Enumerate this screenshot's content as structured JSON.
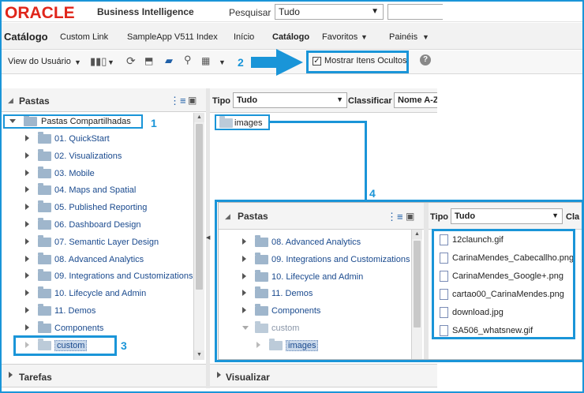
{
  "topbar": {
    "logo": "ORACLE",
    "product": "Business Intelligence",
    "search_label": "Pesquisar",
    "search_scope": "Tudo"
  },
  "nav": {
    "title": "Catálogo",
    "items": [
      "Custom Link",
      "SampleApp V511 Index",
      "Início",
      "Catálogo",
      "Favoritos",
      "Painéis"
    ]
  },
  "toolbar": {
    "view_label": "View do Usuário",
    "show_hidden_label": "Mostrar Itens Ocultos",
    "show_hidden_checked": true
  },
  "left_panel": {
    "title": "Pastas",
    "root": "Pastas Compartilhadas",
    "folders": [
      "01. QuickStart",
      "02. Visualizations",
      "03. Mobile",
      "04. Maps and Spatial",
      "05. Published Reporting",
      "06. Dashboard Design",
      "07. Semantic Layer Design",
      "08. Advanced Analytics",
      "09. Integrations and Customizations",
      "10. Lifecycle and Admin",
      "11. Demos",
      "Components",
      "custom"
    ],
    "tasks_label": "Tarefas"
  },
  "right_panel": {
    "type_label": "Tipo",
    "type_value": "Tudo",
    "sort_label": "Classificar",
    "sort_value": "Nome A-Z",
    "item": "images",
    "preview_label": "Visualizar"
  },
  "zoom_panel": {
    "title": "Pastas",
    "folders": [
      "08. Advanced Analytics",
      "09. Integrations and Customizations",
      "10. Lifecycle and Admin",
      "11. Demos",
      "Components",
      "custom",
      "images"
    ],
    "type_label": "Tipo",
    "type_value": "Tudo",
    "sort_label": "Cla",
    "files": [
      "12claunch.gif",
      "CarinaMendes_Cabecallho.png",
      "CarinaMendes_Google+.png",
      "cartao00_CarinaMendes.png",
      "download.jpg",
      "SA506_whatsnew.gif"
    ]
  },
  "callouts": [
    "1",
    "2",
    "3",
    "4"
  ],
  "colors": {
    "accent": "#1a95d8",
    "oracle_red": "#e0261b",
    "folder": "#9fb6cc",
    "link": "#1a4a8e"
  }
}
